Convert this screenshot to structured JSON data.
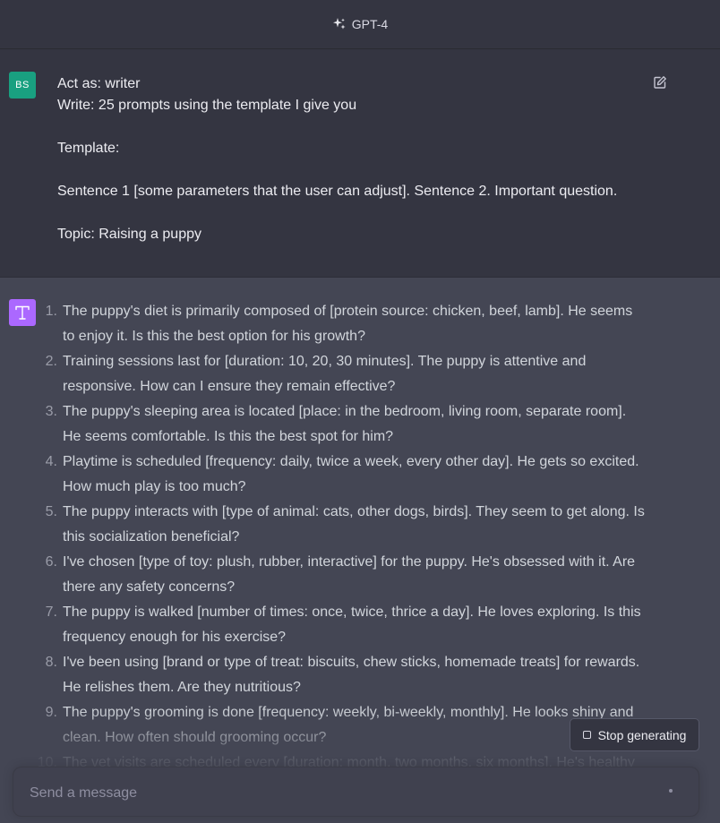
{
  "header": {
    "model_label": "GPT-4",
    "model_icon": "sparkle-icon"
  },
  "user_message": {
    "avatar_initials": "BS",
    "avatar_color": "#19a080",
    "lines": [
      "Act as: writer",
      "Write: 25 prompts using the template I give you",
      "",
      "Template:",
      "",
      "Sentence 1 [some parameters that the user can adjust]. Sentence 2. Important question.",
      "",
      "Topic: Raising a puppy"
    ]
  },
  "assistant_message": {
    "avatar_color": "#ab68ff",
    "items": [
      {
        "number": "1.",
        "lines": [
          "The puppy's diet is primarily composed of [protein source: chicken, beef, lamb]. He seems",
          "to enjoy it. Is this the best option for his growth?"
        ]
      },
      {
        "number": "2.",
        "lines": [
          "Training sessions last for [duration: 10, 20, 30 minutes]. The puppy is attentive and",
          "responsive. How can I ensure they remain effective?"
        ]
      },
      {
        "number": "3.",
        "lines": [
          "The puppy's sleeping area is located [place: in the bedroom, living room, separate room].",
          "He seems comfortable. Is this the best spot for him?"
        ]
      },
      {
        "number": "4.",
        "lines": [
          "Playtime is scheduled [frequency: daily, twice a week, every other day]. He gets so excited.",
          "How much play is too much?"
        ]
      },
      {
        "number": "5.",
        "lines": [
          "The puppy interacts with [type of animal: cats, other dogs, birds]. They seem to get along. Is",
          "this socialization beneficial?"
        ]
      },
      {
        "number": "6.",
        "lines": [
          "I've chosen [type of toy: plush, rubber, interactive] for the puppy. He's obsessed with it. Are",
          "there any safety concerns?"
        ]
      },
      {
        "number": "7.",
        "lines": [
          "The puppy is walked [number of times: once, twice, thrice a day]. He loves exploring. Is this",
          "frequency enough for his exercise?"
        ]
      },
      {
        "number": "8.",
        "lines": [
          "I've been using [brand or type of treat: biscuits, chew sticks, homemade treats] for rewards.",
          "He relishes them. Are they nutritious?"
        ]
      },
      {
        "number": "9.",
        "lines": [
          "The puppy's grooming is done [frequency: weekly, bi-weekly, monthly]. He looks shiny and",
          "clean. How often should grooming occur?"
        ]
      },
      {
        "number": "10.",
        "lines": [
          "The vet visits are scheduled every [duration: month, two months, six months]. He's healthy"
        ]
      }
    ]
  },
  "stop_button": {
    "label": "Stop generating"
  },
  "composer": {
    "placeholder": "Send a message"
  }
}
